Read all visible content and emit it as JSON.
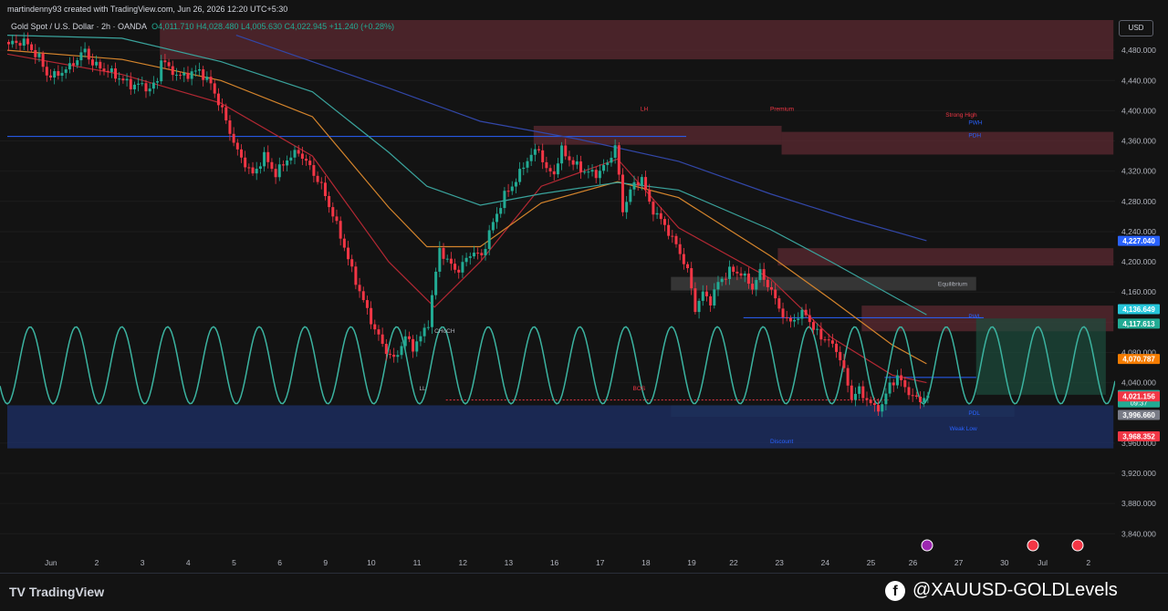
{
  "header": {
    "credit": "martindenny93 created with TradingView.com, Jun 26, 2026 12:20 UTC+5:30",
    "symbol": "Gold Spot / U.S. Dollar · 2h · OANDA",
    "ohlc": "O4,011.710  H4,028.480  L4,005.630  C4,022.945  +11.240 (+0.28%)",
    "currency": "USD"
  },
  "footer": {
    "brand": "TradingView",
    "watermark": "@XAUUSD-GOLDLevels"
  },
  "colors": {
    "background": "#131313",
    "bullish": "#22ab94",
    "bearish": "#f23645",
    "sine": "#3bb3a0",
    "ema_fast": "#b22833",
    "ema_mid": "#d4842c",
    "ema_slow": "#3aa39c",
    "ema_long": "#3247a8",
    "resistance_zone": "#5c2a32",
    "support_zone": "#1c2d5e",
    "equilibrium_zone": "#3a3a3a",
    "target_zone": "#1c4d3d"
  },
  "chart_data": {
    "type": "candlestick",
    "title": "Gold Spot / U.S. Dollar · 2h · OANDA",
    "ylim": [
      3815,
      4520
    ],
    "y_ticks": [
      4480,
      4440,
      4400,
      4360,
      4320,
      4280,
      4240,
      4200,
      4160,
      4120,
      4080,
      4040,
      3960,
      3920,
      3880,
      3840
    ],
    "x_ticks": [
      "Jun",
      "2",
      "3",
      "4",
      "5",
      "6",
      "9",
      "10",
      "11",
      "12",
      "13",
      "16",
      "17",
      "18",
      "19",
      "22",
      "23",
      "24",
      "25",
      "26",
      "27",
      "30",
      "Jul",
      "2"
    ],
    "price_path": [
      [
        0,
        4488
      ],
      [
        4,
        4492
      ],
      [
        8,
        4470
      ],
      [
        10,
        4448
      ],
      [
        12,
        4446
      ],
      [
        16,
        4458
      ],
      [
        20,
        4480
      ],
      [
        22,
        4462
      ],
      [
        27,
        4450
      ],
      [
        30,
        4440
      ],
      [
        32,
        4434
      ],
      [
        35,
        4434
      ],
      [
        37,
        4428
      ],
      [
        39,
        4440
      ],
      [
        40,
        4470
      ],
      [
        42,
        4455
      ],
      [
        45,
        4445
      ],
      [
        48,
        4450
      ],
      [
        50,
        4453
      ],
      [
        53,
        4435
      ],
      [
        56,
        4400
      ],
      [
        60,
        4345
      ],
      [
        64,
        4315
      ],
      [
        67,
        4340
      ],
      [
        70,
        4316
      ],
      [
        73,
        4336
      ],
      [
        76,
        4346
      ],
      [
        79,
        4325
      ],
      [
        82,
        4300
      ],
      [
        85,
        4262
      ],
      [
        88,
        4220
      ],
      [
        90,
        4188
      ],
      [
        93,
        4148
      ],
      [
        96,
        4110
      ],
      [
        99,
        4082
      ],
      [
        101,
        4070
      ],
      [
        104,
        4100
      ],
      [
        106,
        4087
      ],
      [
        108,
        4100
      ],
      [
        110,
        4120
      ],
      [
        113,
        4218
      ],
      [
        115,
        4200
      ],
      [
        118,
        4188
      ],
      [
        121,
        4212
      ],
      [
        124,
        4208
      ],
      [
        127,
        4252
      ],
      [
        130,
        4288
      ],
      [
        133,
        4308
      ],
      [
        136,
        4336
      ],
      [
        139,
        4350
      ],
      [
        141,
        4320
      ],
      [
        143,
        4318
      ],
      [
        145,
        4348
      ],
      [
        148,
        4330
      ],
      [
        151,
        4320
      ],
      [
        154,
        4316
      ],
      [
        157,
        4330
      ],
      [
        159,
        4354
      ],
      [
        161,
        4268
      ],
      [
        163,
        4295
      ],
      [
        166,
        4312
      ],
      [
        168,
        4276
      ],
      [
        171,
        4255
      ],
      [
        173,
        4240
      ],
      [
        176,
        4212
      ],
      [
        178,
        4188
      ],
      [
        180,
        4138
      ],
      [
        182,
        4158
      ],
      [
        184,
        4148
      ],
      [
        186,
        4172
      ],
      [
        189,
        4188
      ],
      [
        192,
        4185
      ],
      [
        195,
        4166
      ],
      [
        197,
        4186
      ],
      [
        199,
        4170
      ],
      [
        201,
        4150
      ],
      [
        204,
        4120
      ],
      [
        207,
        4127
      ],
      [
        209,
        4133
      ],
      [
        211,
        4110
      ],
      [
        214,
        4098
      ],
      [
        217,
        4085
      ],
      [
        219,
        4055
      ],
      [
        221,
        4020
      ],
      [
        223,
        4030
      ],
      [
        225,
        4018
      ],
      [
        227,
        4006
      ],
      [
        229,
        4010
      ],
      [
        231,
        4038
      ],
      [
        233,
        4047
      ],
      [
        235,
        4035
      ],
      [
        237,
        4020
      ],
      [
        239,
        4018
      ],
      [
        241,
        4022.945
      ]
    ],
    "moving_averages": [
      {
        "name": "EMA fast",
        "path": [
          [
            0,
            4475
          ],
          [
            30,
            4448
          ],
          [
            56,
            4410
          ],
          [
            80,
            4340
          ],
          [
            100,
            4200
          ],
          [
            112,
            4140
          ],
          [
            124,
            4200
          ],
          [
            140,
            4300
          ],
          [
            160,
            4336
          ],
          [
            176,
            4245
          ],
          [
            200,
            4178
          ],
          [
            216,
            4100
          ],
          [
            232,
            4050
          ],
          [
            241,
            4040
          ]
        ]
      },
      {
        "name": "EMA mid",
        "path": [
          [
            0,
            4480
          ],
          [
            30,
            4468
          ],
          [
            56,
            4440
          ],
          [
            80,
            4392
          ],
          [
            100,
            4272
          ],
          [
            110,
            4220
          ],
          [
            124,
            4220
          ],
          [
            140,
            4278
          ],
          [
            160,
            4306
          ],
          [
            176,
            4285
          ],
          [
            200,
            4208
          ],
          [
            216,
            4150
          ],
          [
            232,
            4090
          ],
          [
            241,
            4065
          ]
        ]
      },
      {
        "name": "EMA slow",
        "path": [
          [
            0,
            4500
          ],
          [
            30,
            4496
          ],
          [
            56,
            4465
          ],
          [
            80,
            4425
          ],
          [
            100,
            4345
          ],
          [
            110,
            4300
          ],
          [
            124,
            4275
          ],
          [
            140,
            4290
          ],
          [
            160,
            4305
          ],
          [
            176,
            4295
          ],
          [
            200,
            4243
          ],
          [
            216,
            4200
          ],
          [
            232,
            4155
          ],
          [
            241,
            4130
          ]
        ]
      },
      {
        "name": "EMA long",
        "path": [
          [
            60,
            4500
          ],
          [
            100,
            4430
          ],
          [
            124,
            4386
          ],
          [
            150,
            4362
          ],
          [
            176,
            4333
          ],
          [
            200,
            4290
          ],
          [
            220,
            4258
          ],
          [
            241,
            4228
          ]
        ]
      }
    ],
    "zones": [
      {
        "from": 4468,
        "to": 4520,
        "start": 40,
        "end": 290,
        "kind": "resistance"
      },
      {
        "from": 4355,
        "to": 4380,
        "start": 138,
        "end": 203,
        "kind": "resistance"
      },
      {
        "from": 4342,
        "to": 4372,
        "start": 203,
        "end": 290,
        "kind": "resistance"
      },
      {
        "from": 4195,
        "to": 4218,
        "start": 202,
        "end": 290,
        "kind": "resistance"
      },
      {
        "from": 4108,
        "to": 4142,
        "start": 224,
        "end": 290,
        "kind": "resistance"
      },
      {
        "from": 4162,
        "to": 4180,
        "start": 174,
        "end": 254,
        "kind": "equilibrium"
      },
      {
        "from": 3995,
        "to": 4010,
        "start": 174,
        "end": 264,
        "kind": "support_light"
      },
      {
        "from": 3953,
        "to": 4010,
        "start": 0,
        "end": 290,
        "kind": "support"
      },
      {
        "from": 4024,
        "to": 4125,
        "start": 254,
        "end": 288,
        "kind": "target"
      }
    ],
    "horizontal_lines": [
      {
        "price": 4366,
        "start": 0,
        "end": 178
      },
      {
        "price": 4126,
        "start": 193,
        "end": 256
      },
      {
        "price": 4047,
        "start": 230,
        "end": 254
      },
      {
        "price": 4017,
        "start": 115,
        "end": 231,
        "dashed": true
      }
    ],
    "annotations": [
      "Premium",
      "Equilibrium",
      "Discount",
      "LH",
      "LL",
      "BOS",
      "CHoCH",
      "PWH",
      "PWL",
      "PDH",
      "PDL",
      "Strong High",
      "Weak Low"
    ],
    "price_labels": [
      {
        "price": 4227.04,
        "text": "4,227.040",
        "color": "#2962ff"
      },
      {
        "price": 4136.649,
        "text": "4,136.649",
        "color": "#26c6da"
      },
      {
        "price": 4117.613,
        "text": "4,117.613",
        "color": "#22ab94"
      },
      {
        "price": 4070.787,
        "text": "4,070.787",
        "color": "#f57c00"
      },
      {
        "price": 4022.945,
        "text": "4,022.945",
        "sub": "09:37",
        "color": "#22ab94"
      },
      {
        "price": 4022.8,
        "text": "4,022.800",
        "color": "#26a69a"
      },
      {
        "price": 4021.156,
        "text": "4,021.156",
        "color": "#f23645"
      },
      {
        "price": 3996.66,
        "text": "3,996.660",
        "color": "#787b86"
      },
      {
        "price": 3968.352,
        "text": "3,968.352",
        "color": "#f23645"
      }
    ]
  }
}
